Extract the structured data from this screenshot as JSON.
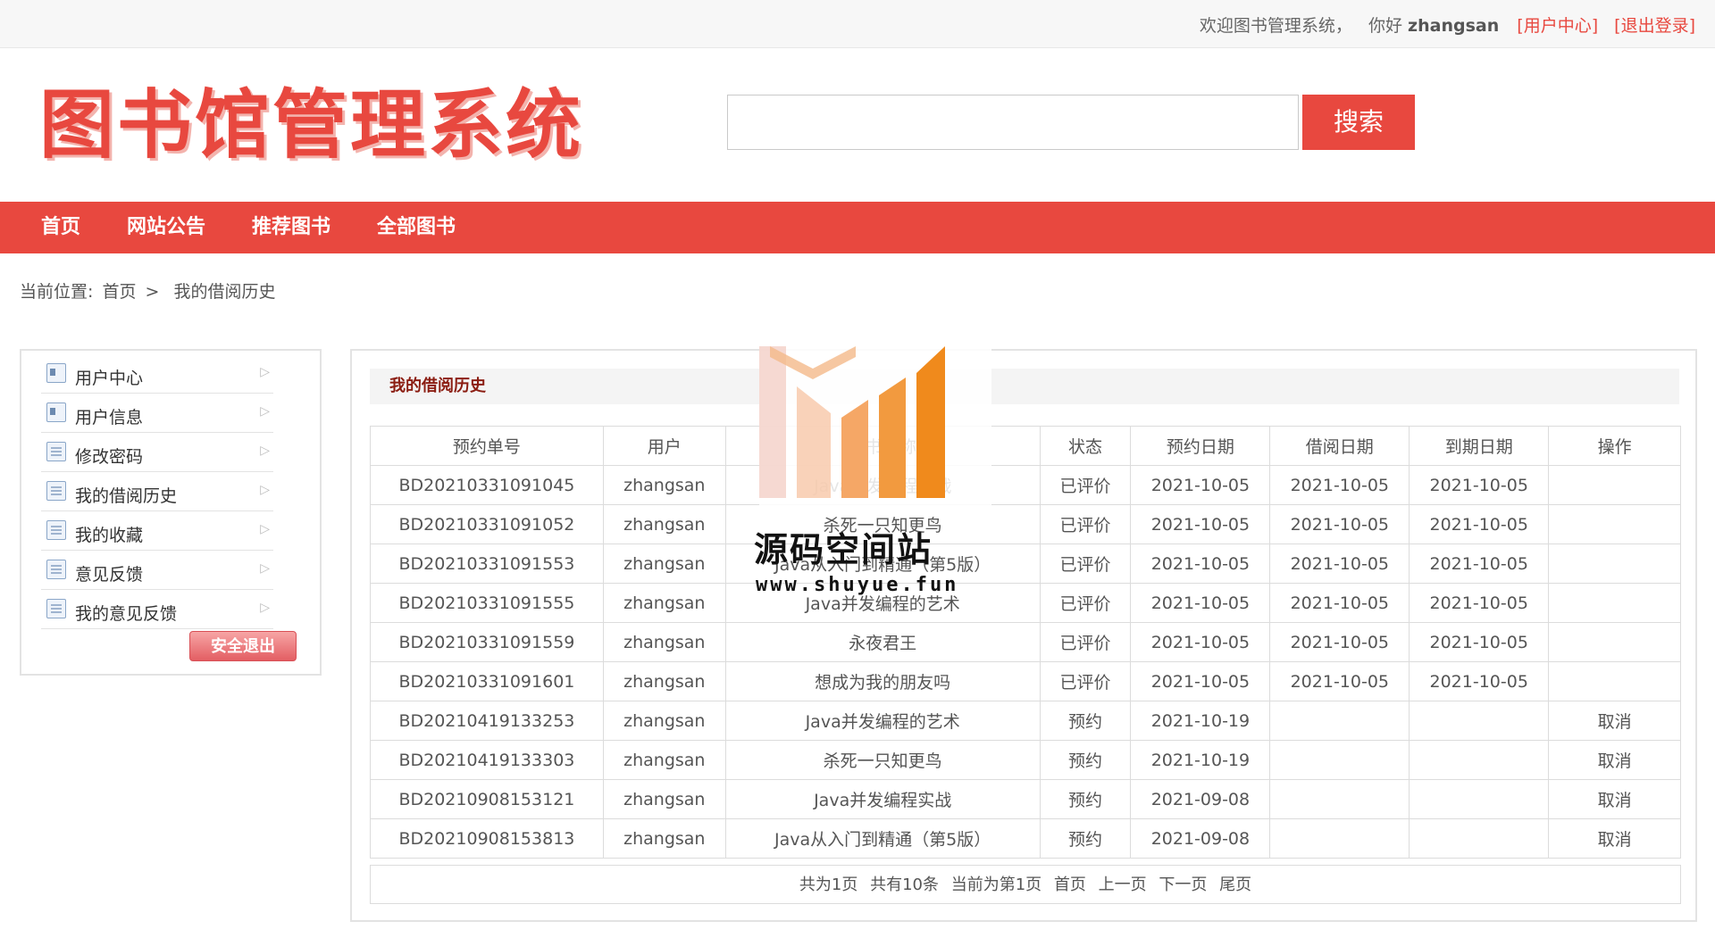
{
  "topbar": {
    "welcome": "欢迎图书管理系统，",
    "greeting": "你好",
    "username": "zhangsan",
    "user_center_link": "[用户中心]",
    "logout_link": "[退出登录]"
  },
  "header": {
    "logo_text": "图书馆管理系统",
    "search_placeholder": "",
    "search_button": "搜索"
  },
  "nav": {
    "items": [
      "首页",
      "网站公告",
      "推荐图书",
      "全部图书"
    ]
  },
  "breadcrumb": {
    "prefix": "当前位置:",
    "home": "首页",
    "separator": ">",
    "current": "我的借阅历史"
  },
  "sidebar": {
    "items": [
      {
        "label": "用户中心",
        "icon": "id-card-icon"
      },
      {
        "label": "用户信息",
        "icon": "id-card-icon"
      },
      {
        "label": "修改密码",
        "icon": "document-icon"
      },
      {
        "label": "我的借阅历史",
        "icon": "document-icon"
      },
      {
        "label": "我的收藏",
        "icon": "document-icon"
      },
      {
        "label": "意见反馈",
        "icon": "document-icon"
      },
      {
        "label": "我的意见反馈",
        "icon": "document-icon"
      }
    ],
    "logout_button": "安全退出"
  },
  "main": {
    "panel_title": "我的借阅历史",
    "columns": [
      "预约单号",
      "用户",
      "图书名称",
      "状态",
      "预约日期",
      "借阅日期",
      "到期日期",
      "操作"
    ],
    "rows": [
      [
        "BD20210331091045",
        "zhangsan",
        "Java并发编程实战",
        "已评价",
        "2021-10-05",
        "2021-10-05",
        "2021-10-05",
        ""
      ],
      [
        "BD20210331091052",
        "zhangsan",
        "杀死一只知更鸟",
        "已评价",
        "2021-10-05",
        "2021-10-05",
        "2021-10-05",
        ""
      ],
      [
        "BD20210331091553",
        "zhangsan",
        "Java从入门到精通（第5版）",
        "已评价",
        "2021-10-05",
        "2021-10-05",
        "2021-10-05",
        ""
      ],
      [
        "BD20210331091555",
        "zhangsan",
        "Java并发编程的艺术",
        "已评价",
        "2021-10-05",
        "2021-10-05",
        "2021-10-05",
        ""
      ],
      [
        "BD20210331091559",
        "zhangsan",
        "永夜君王",
        "已评价",
        "2021-10-05",
        "2021-10-05",
        "2021-10-05",
        ""
      ],
      [
        "BD20210331091601",
        "zhangsan",
        "想成为我的朋友吗",
        "已评价",
        "2021-10-05",
        "2021-10-05",
        "2021-10-05",
        ""
      ],
      [
        "BD20210419133253",
        "zhangsan",
        "Java并发编程的艺术",
        "预约",
        "2021-10-19",
        "",
        "",
        "取消"
      ],
      [
        "BD20210419133303",
        "zhangsan",
        "杀死一只知更鸟",
        "预约",
        "2021-10-19",
        "",
        "",
        "取消"
      ],
      [
        "BD20210908153121",
        "zhangsan",
        "Java并发编程实战",
        "预约",
        "2021-09-08",
        "",
        "",
        "取消"
      ],
      [
        "BD20210908153813",
        "zhangsan",
        "Java从入门到精通（第5版）",
        "预约",
        "2021-09-08",
        "",
        "",
        "取消"
      ]
    ],
    "pager": {
      "total_pages": "共为1页",
      "total_records": "共有10条",
      "current_page": "当前为第1页",
      "first": "首页",
      "prev": "上一页",
      "next": "下一页",
      "last": "尾页"
    }
  },
  "watermark": {
    "title": "源码空间站",
    "url": "www.shuyue.fun"
  },
  "colors": {
    "brand_red": "#e8483f",
    "panel_title": "#8b1d12",
    "watermark_orange": "#f08a1c"
  }
}
